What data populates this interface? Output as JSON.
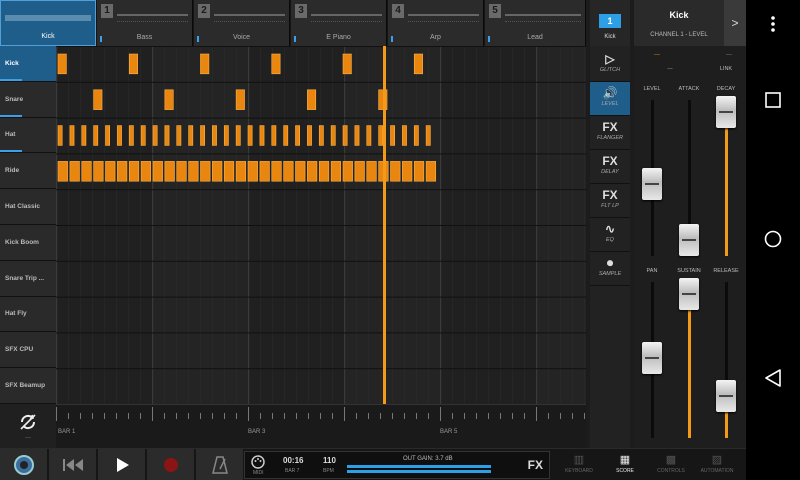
{
  "tracks": [
    {
      "num": "",
      "name": "Kick",
      "active": true
    },
    {
      "num": "1",
      "name": "Bass"
    },
    {
      "num": "2",
      "name": "Voice"
    },
    {
      "num": "3",
      "name": "E Piano"
    },
    {
      "num": "4",
      "name": "Arp"
    },
    {
      "num": "5",
      "name": "Lead"
    }
  ],
  "instruments": [
    "Kick",
    "Snare",
    "Hat",
    "Ride",
    "Hat Classic",
    "Kick Boom",
    "Snare Trip ...",
    "Hat Fly",
    "SFX CPU",
    "SFX Beamup"
  ],
  "ruler": {
    "labels": [
      "BAR 1",
      "BAR 3",
      "BAR 5"
    ],
    "loop_dots": "..."
  },
  "fx": {
    "track_num": "1",
    "track_label": "Kick",
    "buttons": [
      {
        "icon": "▷",
        "sub": "GLITCH"
      },
      {
        "icon": "🔊",
        "sub": "LEVEL"
      },
      {
        "icon": "FX",
        "sub": "FLANGER"
      },
      {
        "icon": "FX",
        "sub": "DELAY"
      },
      {
        "icon": "FX",
        "sub": "FLT LP"
      },
      {
        "icon": "∿",
        "sub": "EQ"
      },
      {
        "icon": "⏺",
        "sub": "SAMPLE"
      }
    ]
  },
  "channel": {
    "name": "Kick",
    "sub": "CHANNEL 1 - LEVEL",
    "next": ">"
  },
  "mixer": {
    "mini_left": "---",
    "mini_left_sub": "---",
    "mini_right": "---",
    "mini_right_sub": "LINK",
    "labels": [
      "LEVEL",
      "ATTACK",
      "DECAY",
      "PAN",
      "SUSTAIN",
      "RELEASE"
    ]
  },
  "transport": {
    "time": "00:16",
    "time_sub": "BAR 7",
    "bpm": "110",
    "bpm_sub": "BPM",
    "midi_label": "MIDI",
    "gain": "OUT GAIN: 3.7 dB",
    "fx": "FX",
    "views": [
      {
        "label": "KEYBOARD",
        "icon": "▥"
      },
      {
        "label": "SCORE",
        "icon": "▦",
        "active": true
      },
      {
        "label": "CONTROLS",
        "icon": "▩"
      },
      {
        "label": "AUTOMATION",
        "icon": "▨"
      }
    ]
  },
  "colors": {
    "accent": "#f39a18",
    "blue": "#2d9fe6",
    "selected": "#1f5d8a"
  },
  "pattern": {
    "step_fraction": 0.0625,
    "playhead_bar": 4.7
  }
}
